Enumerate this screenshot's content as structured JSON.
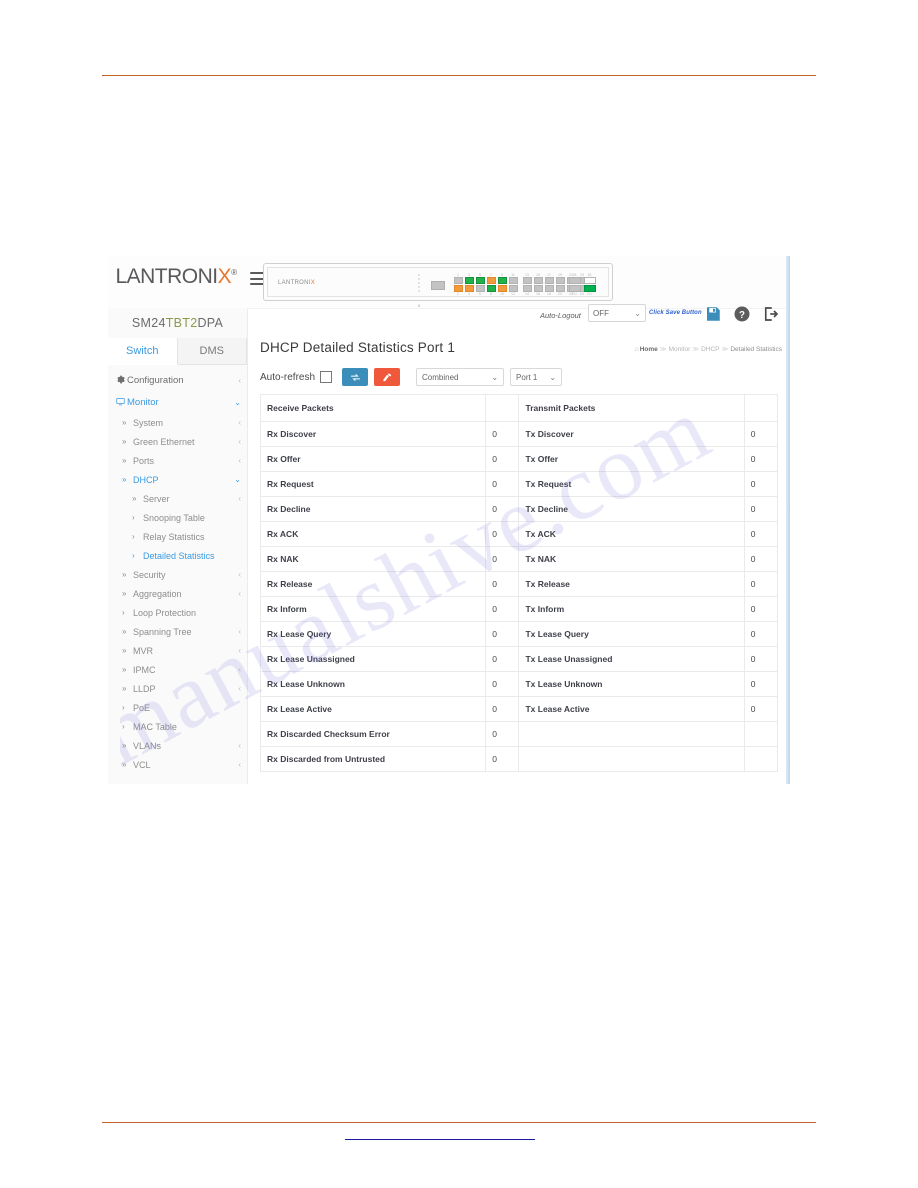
{
  "document": {
    "watermark": "manualshive.com"
  },
  "topbar": {
    "brand": "LANTRONIX",
    "brand_mark": "®",
    "menu_icon": "hamburger-icon",
    "device": {
      "logo": "LANTRONIX",
      "zero_label": "0",
      "port_numbers_top": [
        "1",
        "3",
        "5",
        "7",
        "9",
        "11",
        "13",
        "15",
        "17",
        "19",
        "21",
        "23"
      ],
      "port_numbers_bottom": [
        "2",
        "4",
        "6",
        "8",
        "10",
        "12",
        "14",
        "16",
        "18",
        "20",
        "22",
        "24"
      ],
      "uplink_labels": [
        "25",
        "26"
      ],
      "uplink_sub_labels": [
        "RJ",
        "RJ"
      ]
    },
    "auto_logout_label": "Auto-Logout",
    "auto_logout_value": "OFF",
    "save_hint": "Click Save Button",
    "icons": {
      "save": "save-icon",
      "help": "help-icon",
      "logout": "logout-icon"
    }
  },
  "sidebar": {
    "model": "SM24TBT2DPA",
    "tabs": [
      {
        "label": "Switch",
        "active": true
      },
      {
        "label": "DMS",
        "active": false
      }
    ],
    "items": [
      {
        "label": "Configuration",
        "level": 0,
        "icon": "gear-icon",
        "caret": "‹",
        "active": false
      },
      {
        "label": "Monitor",
        "level": 0,
        "icon": "monitor-icon",
        "caret": "⌄",
        "active": true
      },
      {
        "label": "System",
        "level": 1,
        "icon": "»",
        "caret": "‹",
        "active": false
      },
      {
        "label": "Green Ethernet",
        "level": 1,
        "icon": "»",
        "caret": "‹",
        "active": false
      },
      {
        "label": "Ports",
        "level": 1,
        "icon": "»",
        "caret": "‹",
        "active": false
      },
      {
        "label": "DHCP",
        "level": 1,
        "icon": "»",
        "caret": "⌄",
        "active": true
      },
      {
        "label": "Server",
        "level": 2,
        "icon": "»",
        "caret": "‹",
        "active": false
      },
      {
        "label": "Snooping Table",
        "level": 2,
        "icon": "›",
        "caret": "",
        "active": false
      },
      {
        "label": "Relay Statistics",
        "level": 2,
        "icon": "›",
        "caret": "",
        "active": false
      },
      {
        "label": "Detailed Statistics",
        "level": 2,
        "icon": "›",
        "caret": "",
        "active": true
      },
      {
        "label": "Security",
        "level": 1,
        "icon": "»",
        "caret": "‹",
        "active": false
      },
      {
        "label": "Aggregation",
        "level": 1,
        "icon": "»",
        "caret": "‹",
        "active": false
      },
      {
        "label": "Loop Protection",
        "level": 1,
        "icon": "›",
        "caret": "",
        "active": false
      },
      {
        "label": "Spanning Tree",
        "level": 1,
        "icon": "»",
        "caret": "‹",
        "active": false
      },
      {
        "label": "MVR",
        "level": 1,
        "icon": "»",
        "caret": "‹",
        "active": false
      },
      {
        "label": "IPMC",
        "level": 1,
        "icon": "»",
        "caret": "‹",
        "active": false
      },
      {
        "label": "LLDP",
        "level": 1,
        "icon": "»",
        "caret": "‹",
        "active": false
      },
      {
        "label": "PoE",
        "level": 1,
        "icon": "›",
        "caret": "",
        "active": false
      },
      {
        "label": "MAC Table",
        "level": 1,
        "icon": "›",
        "caret": "",
        "active": false
      },
      {
        "label": "VLANs",
        "level": 1,
        "icon": "»",
        "caret": "‹",
        "active": false
      },
      {
        "label": "VCL",
        "level": 1,
        "icon": "»",
        "caret": "‹",
        "active": false
      }
    ]
  },
  "main": {
    "title": "DHCP Detailed Statistics  Port 1",
    "breadcrumb": {
      "home": "Home",
      "items": [
        "Monitor",
        "DHCP"
      ],
      "current": "Detailed Statistics",
      "separator": "≫"
    },
    "toolbar": {
      "auto_refresh_label": "Auto-refresh",
      "auto_refresh_checked": false,
      "refresh_icon": "refresh-icon",
      "clear_icon": "eraser-icon",
      "mode_select": "Combined",
      "port_select": "Port 1"
    },
    "table": {
      "headers": [
        "Receive Packets",
        "",
        "Transmit Packets",
        ""
      ],
      "rows": [
        {
          "rx_name": "Rx Discover",
          "rx_val": "0",
          "tx_name": "Tx Discover",
          "tx_val": "0"
        },
        {
          "rx_name": "Rx Offer",
          "rx_val": "0",
          "tx_name": "Tx Offer",
          "tx_val": "0"
        },
        {
          "rx_name": "Rx Request",
          "rx_val": "0",
          "tx_name": "Tx Request",
          "tx_val": "0"
        },
        {
          "rx_name": "Rx Decline",
          "rx_val": "0",
          "tx_name": "Tx Decline",
          "tx_val": "0"
        },
        {
          "rx_name": "Rx ACK",
          "rx_val": "0",
          "tx_name": "Tx ACK",
          "tx_val": "0"
        },
        {
          "rx_name": "Rx NAK",
          "rx_val": "0",
          "tx_name": "Tx NAK",
          "tx_val": "0"
        },
        {
          "rx_name": "Rx Release",
          "rx_val": "0",
          "tx_name": "Tx Release",
          "tx_val": "0"
        },
        {
          "rx_name": "Rx Inform",
          "rx_val": "0",
          "tx_name": "Tx Inform",
          "tx_val": "0"
        },
        {
          "rx_name": "Rx Lease Query",
          "rx_val": "0",
          "tx_name": "Tx Lease Query",
          "tx_val": "0"
        },
        {
          "rx_name": "Rx Lease Unassigned",
          "rx_val": "0",
          "tx_name": "Tx Lease Unassigned",
          "tx_val": "0"
        },
        {
          "rx_name": "Rx Lease Unknown",
          "rx_val": "0",
          "tx_name": "Tx Lease Unknown",
          "tx_val": "0"
        },
        {
          "rx_name": "Rx Lease Active",
          "rx_val": "0",
          "tx_name": "Tx Lease Active",
          "tx_val": "0"
        },
        {
          "rx_name": "Rx Discarded Checksum Error",
          "rx_val": "0",
          "tx_name": "",
          "tx_val": ""
        },
        {
          "rx_name": "Rx Discarded from Untrusted",
          "rx_val": "0",
          "tx_name": "",
          "tx_val": ""
        }
      ]
    }
  }
}
